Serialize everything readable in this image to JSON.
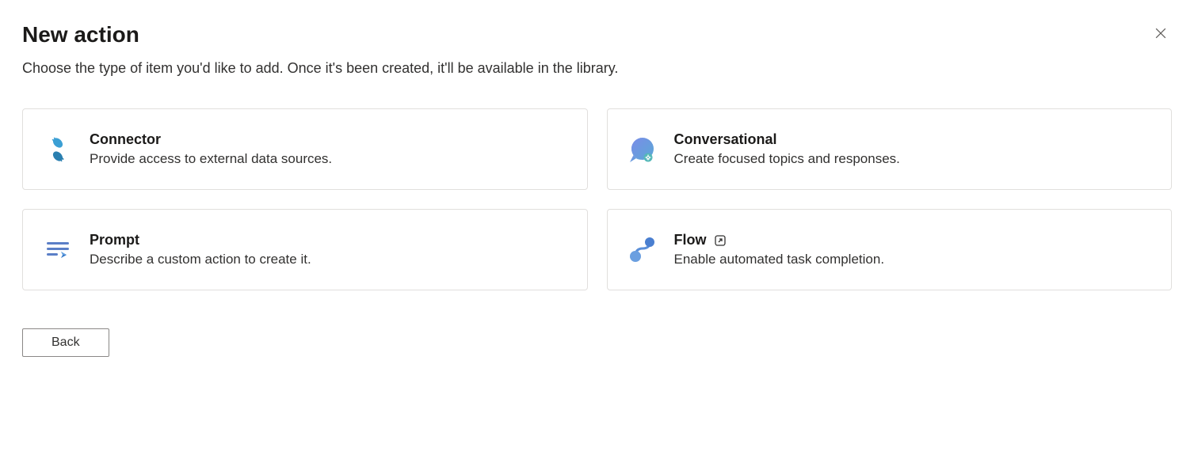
{
  "header": {
    "title": "New action",
    "subtitle": "Choose the type of item you'd like to add. Once it's been created, it'll be available in the library."
  },
  "cards": {
    "connector": {
      "title": "Connector",
      "desc": "Provide access to external data sources."
    },
    "conversational": {
      "title": "Conversational",
      "desc": "Create focused topics and responses."
    },
    "prompt": {
      "title": "Prompt",
      "desc": "Describe a custom action to create it."
    },
    "flow": {
      "title": "Flow",
      "desc": "Enable automated task completion."
    }
  },
  "footer": {
    "back_label": "Back"
  }
}
